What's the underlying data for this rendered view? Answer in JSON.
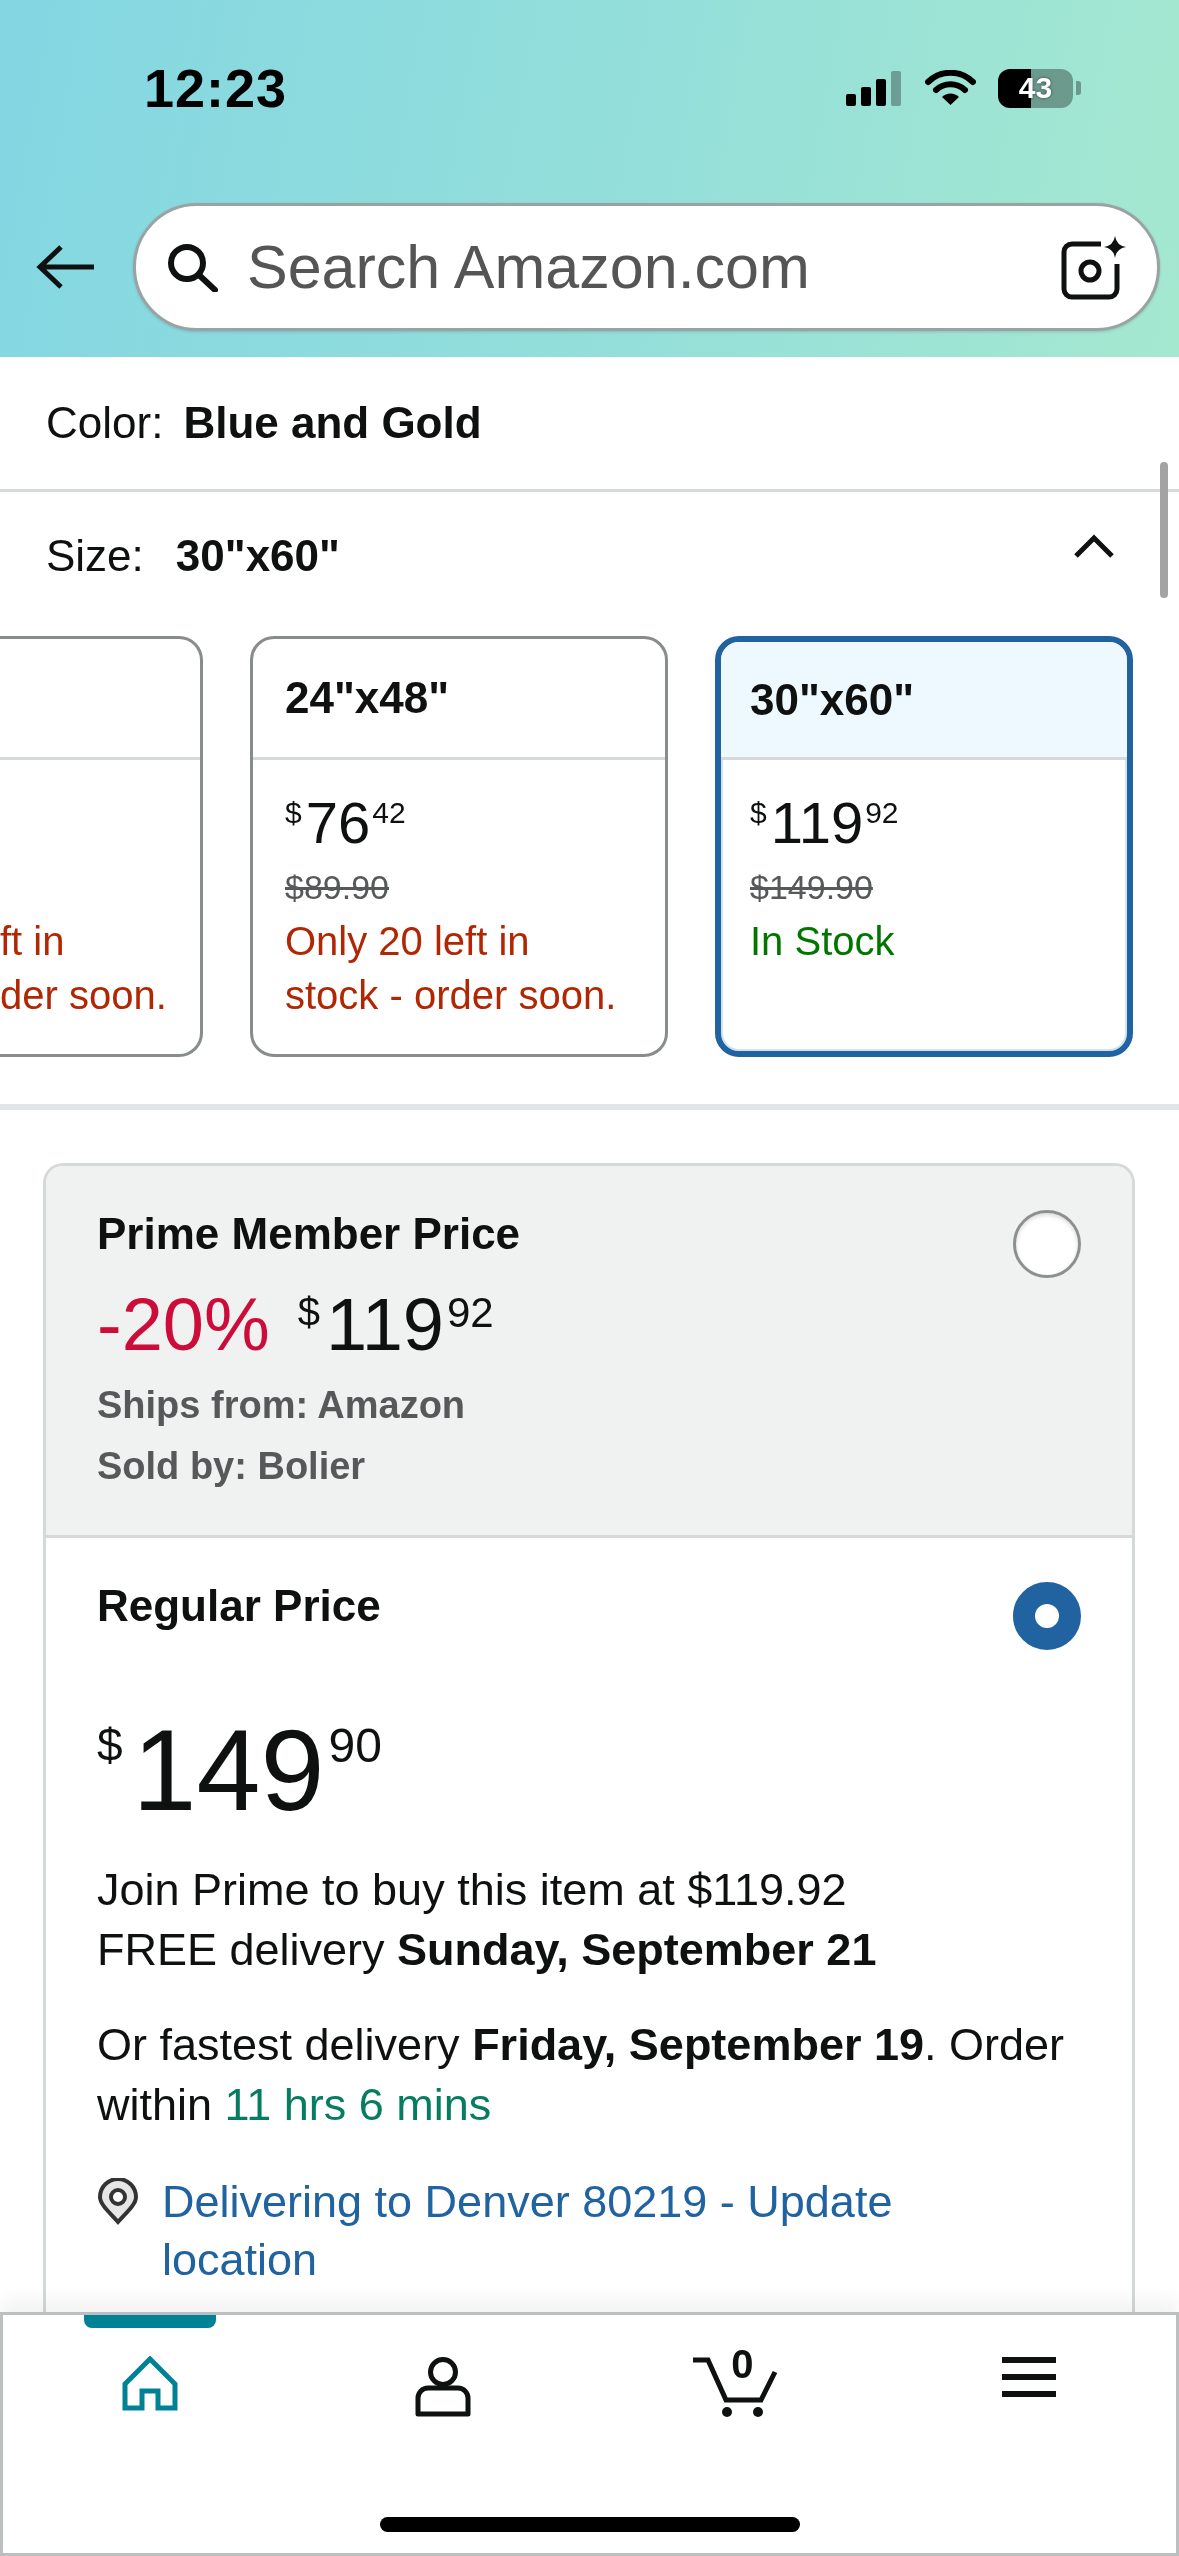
{
  "status_bar": {
    "time": "12:23",
    "battery": "43"
  },
  "search": {
    "placeholder": "Search Amazon.com"
  },
  "color_option": {
    "label": "Color:",
    "value": "Blue and Gold"
  },
  "size_option": {
    "label": "Size:",
    "value": "30\"x60\"",
    "expanded": true
  },
  "size_cards": [
    {
      "kind": "partial",
      "selected": false,
      "stock": "ft in\nder soon.",
      "color": "#b12704"
    },
    {
      "kind": "full",
      "selected": false,
      "size": "24\"x48\"",
      "price": {
        "symbol": "$",
        "whole": "76",
        "fraction": "42"
      },
      "list_price": "$89.90",
      "stock": "Only 20 left in stock - order soon.",
      "color": "#b12704"
    },
    {
      "kind": "full",
      "selected": true,
      "size": "30\"x60\"",
      "price": {
        "symbol": "$",
        "whole": "119",
        "fraction": "92"
      },
      "list_price": "$149.90",
      "stock": "In Stock",
      "color": "#007600"
    }
  ],
  "offers": [
    {
      "kind": "prime",
      "selected": false,
      "title": "Prime Member Price",
      "discount": "-20%",
      "price": {
        "symbol": "$",
        "whole": "119",
        "fraction": "92"
      },
      "ships_from": "Ships from: Amazon",
      "sold_by": "Sold by: Bolier"
    },
    {
      "kind": "regular",
      "selected": true,
      "title": "Regular Price",
      "price": {
        "symbol": "$",
        "whole": "149",
        "fraction": "90"
      },
      "prime_offer": "Join Prime to buy this item at $119.92",
      "free_delivery": "FREE delivery **Sunday, September 21**",
      "fastest_delivery": "Or fastest delivery **Friday, September 19**. Order within",
      "countdown": "11 hrs 6 mins",
      "location_link": "Delivering to Denver 80219 - Update location"
    }
  ],
  "bottom_nav": [
    {
      "kind": "home",
      "selected": true
    },
    {
      "kind": "account",
      "selected": false
    },
    {
      "kind": "cart",
      "selected": false,
      "count": "0"
    },
    {
      "kind": "menu",
      "selected": false
    }
  ]
}
